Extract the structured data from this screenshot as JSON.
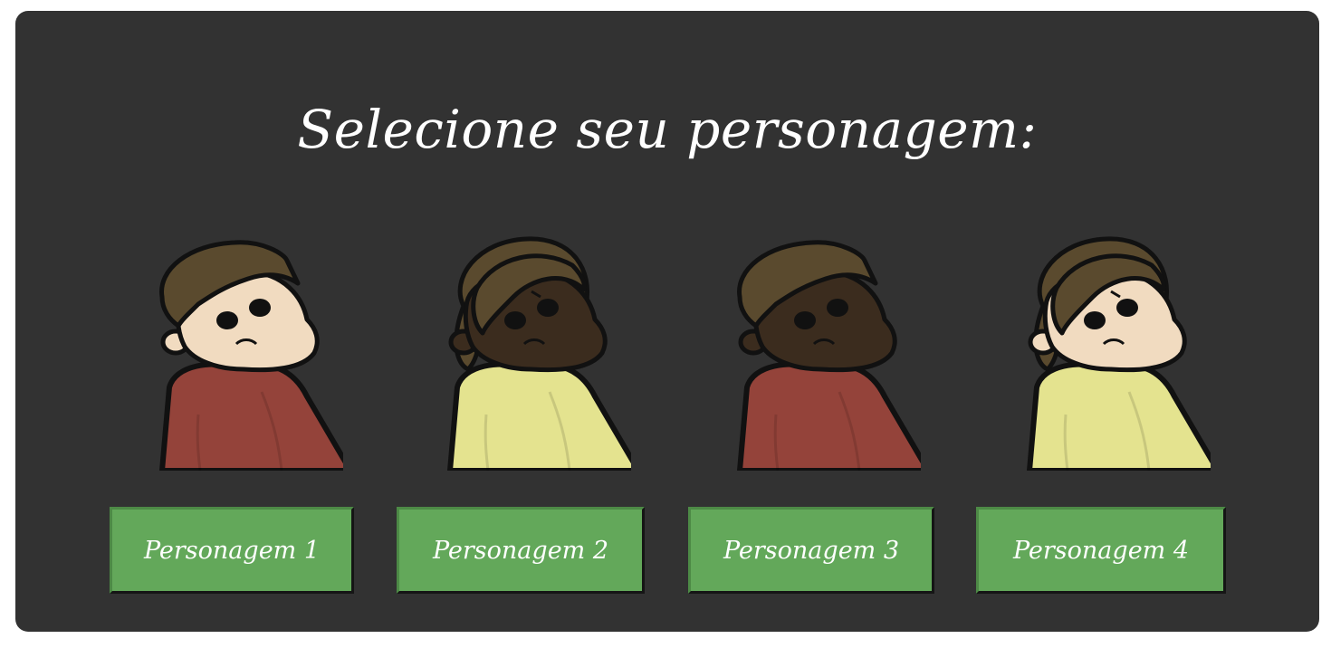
{
  "screen": {
    "title": "Selecione seu personagem:",
    "background_color": "#323232",
    "button_color": "#63a85a"
  },
  "characters": [
    {
      "button_label": "Personagem 1",
      "hair": "short",
      "skin_color": "#f1dbc0",
      "shirt_color": "#94433a",
      "hair_color": "#5a4a2e"
    },
    {
      "button_label": "Personagem 2",
      "hair": "long",
      "skin_color": "#3b2c1e",
      "shirt_color": "#e4e38f",
      "hair_color": "#5a4a2e"
    },
    {
      "button_label": "Personagem 3",
      "hair": "short",
      "skin_color": "#3b2c1e",
      "shirt_color": "#94433a",
      "hair_color": "#5a4a2e"
    },
    {
      "button_label": "Personagem 4",
      "hair": "long",
      "skin_color": "#f1dbc0",
      "shirt_color": "#e4e38f",
      "hair_color": "#5a4a2e"
    }
  ]
}
